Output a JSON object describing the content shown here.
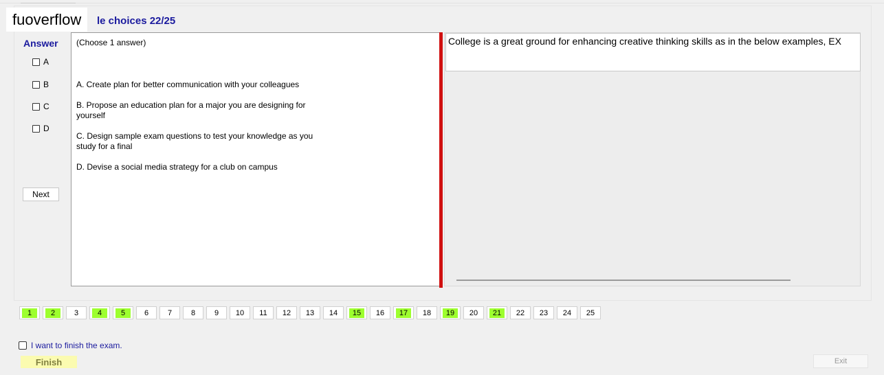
{
  "app": {
    "watermark": "fuoverflow"
  },
  "header": {
    "title": "le choices 22/25"
  },
  "answer": {
    "label": "Answer",
    "options": [
      "A",
      "B",
      "C",
      "D"
    ],
    "next_label": "Next"
  },
  "question": {
    "instruction": "(Choose 1 answer)",
    "choices": [
      {
        "line1": "A.  Create plan for better communication with your colleagues",
        "line2": ""
      },
      {
        "line1": "B.  Propose an education plan for a major you are designing for",
        "line2": "yourself"
      },
      {
        "line1": "C.  Design sample exam questions to test your knowledge as you",
        "line2": "study for a final"
      },
      {
        "line1": "D.  Devise a social media strategy for a club on campus",
        "line2": ""
      }
    ]
  },
  "right_panel": {
    "text": "College is a great ground for enhancing creative thinking skills as in the below examples, EX"
  },
  "navigator": {
    "numbers": [
      "1",
      "2",
      "3",
      "4",
      "5",
      "6",
      "7",
      "8",
      "9",
      "10",
      "11",
      "12",
      "13",
      "14",
      "15",
      "16",
      "17",
      "18",
      "19",
      "20",
      "21",
      "22",
      "23",
      "24",
      "25"
    ],
    "answered": [
      1,
      2,
      4,
      5,
      15,
      17,
      19,
      21
    ],
    "answered_color": "#9dff2e"
  },
  "footer": {
    "finish_checkbox_label": "I want to finish the exam.",
    "finish_label": "Finish",
    "exit_label": "Exit"
  }
}
